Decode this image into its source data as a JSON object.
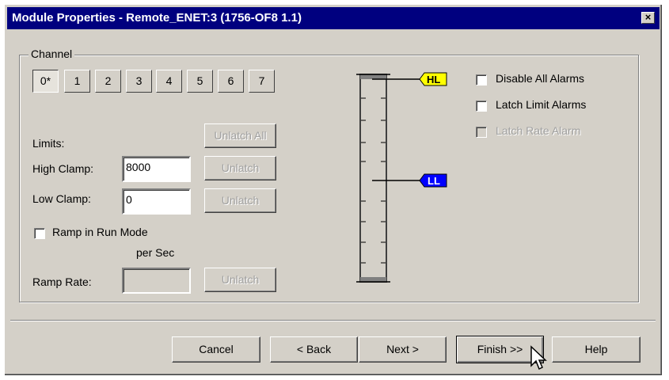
{
  "window": {
    "title": "Module Properties - Remote_ENET:3 (1756-OF8 1.1)",
    "close_glyph": "×"
  },
  "channel": {
    "legend": "Channel",
    "tabs": [
      "0*",
      "1",
      "2",
      "3",
      "4",
      "5",
      "6",
      "7"
    ],
    "selected_tab": "0*"
  },
  "limits": {
    "heading": "Limits:",
    "unlatch_all_label": "Unlatch All",
    "high_clamp_label": "High Clamp:",
    "high_clamp_value": "8000",
    "high_unlatch_label": "Unlatch",
    "low_clamp_label": "Low Clamp:",
    "low_clamp_value": "0",
    "low_unlatch_label": "Unlatch"
  },
  "ramp": {
    "ramp_in_run_label": "Ramp in Run Mode",
    "per_sec_label": "per Sec",
    "ramp_rate_label": "Ramp Rate:",
    "ramp_rate_value": "",
    "ramp_unlatch_label": "Unlatch"
  },
  "gauge": {
    "high_marker": "HL",
    "low_marker": "LL",
    "high_color": "#ffff00",
    "low_color": "#0000ff"
  },
  "alarms": {
    "disable_all_label": "Disable All Alarms",
    "latch_limit_label": "Latch Limit Alarms",
    "latch_rate_label": "Latch Rate Alarm"
  },
  "footer": {
    "cancel_label": "Cancel",
    "back_label": "< Back",
    "next_label": "Next >",
    "finish_label": "Finish >>",
    "help_label": "Help"
  }
}
